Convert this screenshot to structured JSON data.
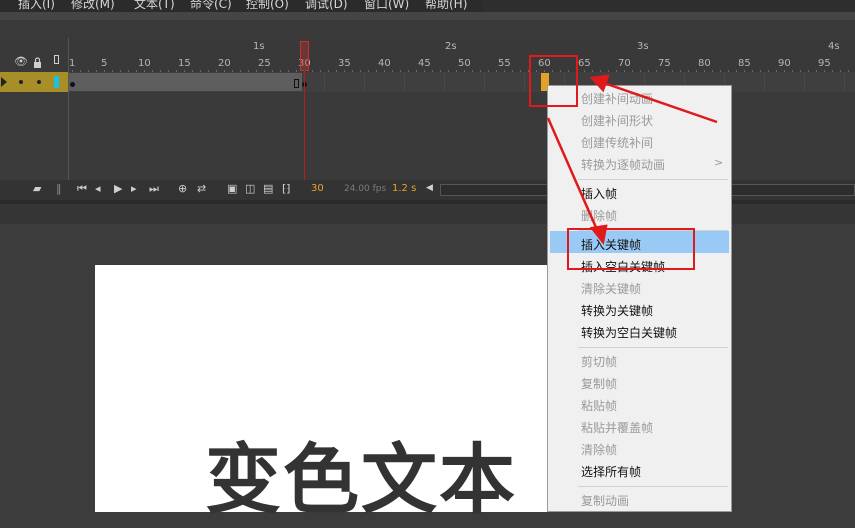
{
  "menubar": {
    "items": [
      "插入(I)",
      "修改(M)",
      "文本(T)",
      "命令(C)",
      "控制(O)",
      "调试(D)",
      "窗口(W)",
      "帮助(H)"
    ]
  },
  "timeline": {
    "seconds": [
      "1s",
      "2s",
      "3s",
      "4s"
    ],
    "frame_numbers": [
      "1",
      "5",
      "10",
      "15",
      "20",
      "25",
      "30",
      "35",
      "40",
      "45",
      "50",
      "55",
      "60",
      "65",
      "70",
      "75",
      "80",
      "85",
      "90",
      "95"
    ],
    "current_frame": "30",
    "fps": "24.00 fps",
    "elapsed": "1.2 s",
    "layer_icons": [
      "eye-icon",
      "lock-icon",
      "outline-icon"
    ]
  },
  "stage": {
    "text": "变色文本"
  },
  "context_menu": {
    "groups": [
      [
        {
          "label": "创建补间动画",
          "enabled": false
        },
        {
          "label": "创建补间形状",
          "enabled": false
        },
        {
          "label": "创建传统补间",
          "enabled": false
        },
        {
          "label": "转换为逐帧动画",
          "enabled": false,
          "submenu": true
        }
      ],
      [
        {
          "label": "插入帧",
          "enabled": true
        },
        {
          "label": "删除帧",
          "enabled": false
        }
      ],
      [
        {
          "label": "插入关键帧",
          "enabled": true,
          "highlighted": true
        },
        {
          "label": "插入空白关键帧",
          "enabled": true
        },
        {
          "label": "清除关键帧",
          "enabled": false
        },
        {
          "label": "转换为关键帧",
          "enabled": true
        },
        {
          "label": "转换为空白关键帧",
          "enabled": true
        }
      ],
      [
        {
          "label": "剪切帧",
          "enabled": false
        },
        {
          "label": "复制帧",
          "enabled": false
        },
        {
          "label": "粘贴帧",
          "enabled": false
        },
        {
          "label": "粘贴并覆盖帧",
          "enabled": false
        },
        {
          "label": "清除帧",
          "enabled": false
        },
        {
          "label": "选择所有帧",
          "enabled": true
        }
      ],
      [
        {
          "label": "复制动画",
          "enabled": false
        }
      ]
    ],
    "submenu_arrow": ">",
    "highlight_color": "#99c9f5"
  },
  "annotation_color": "#e01a1a",
  "accent_color": "#e5a42b"
}
